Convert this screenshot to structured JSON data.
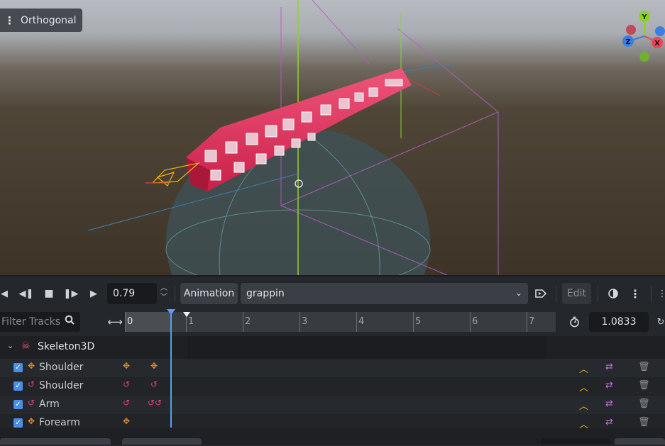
{
  "viewport": {
    "view_mode_label": "Orthogonal",
    "gizmo": {
      "y": "Y",
      "x": "X",
      "z": "Z"
    }
  },
  "toolbar": {
    "time_value": "0.79",
    "animation_label": "Animation",
    "animation_name": "grappin",
    "edit_label": "Edit"
  },
  "timeline": {
    "filter_placeholder": "Filter Tracks",
    "ticks": [
      "0",
      "1",
      "2",
      "3",
      "4",
      "5",
      "6",
      "7"
    ],
    "length_value": "1.0833"
  },
  "tracks": {
    "group_label": "Skeleton3D",
    "items": [
      {
        "label": "Shoulder",
        "kind": "position"
      },
      {
        "label": "Shoulder",
        "kind": "rotation"
      },
      {
        "label": "Arm",
        "kind": "rotation"
      },
      {
        "label": "Forearm",
        "kind": "position"
      }
    ]
  },
  "colors": {
    "accent": "#4a8fe7",
    "position_track": "#e98b2a",
    "rotation_track": "#e0427a",
    "interp": "#f0c419",
    "loop": "#c66be0"
  }
}
